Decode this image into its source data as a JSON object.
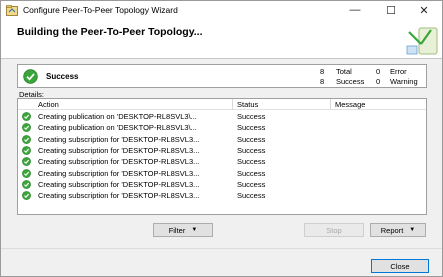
{
  "window": {
    "title": "Configure Peer-To-Peer Topology Wizard",
    "controls": {
      "minimize": "—",
      "maximize": "☐",
      "close": "✕"
    }
  },
  "header": {
    "title": "Building the Peer-To-Peer Topology..."
  },
  "summary": {
    "status": "Success",
    "total_count": "8",
    "total_label": "Total",
    "success_count": "8",
    "success_label": "Success",
    "error_count": "0",
    "error_label": "Error",
    "warning_count": "0",
    "warning_label": "Warning"
  },
  "details": {
    "label": "Details:",
    "columns": {
      "action": "Action",
      "status": "Status",
      "message": "Message"
    },
    "rows": [
      {
        "action": "Creating publication on 'DESKTOP-RL8SVL3\\...",
        "status": "Success",
        "message": ""
      },
      {
        "action": "Creating publication on 'DESKTOP-RL8SVL3\\...",
        "status": "Success",
        "message": ""
      },
      {
        "action": "Creating subscription for 'DESKTOP-RL8SVL3...",
        "status": "Success",
        "message": ""
      },
      {
        "action": "Creating subscription for 'DESKTOP-RL8SVL3...",
        "status": "Success",
        "message": ""
      },
      {
        "action": "Creating subscription for 'DESKTOP-RL8SVL3...",
        "status": "Success",
        "message": ""
      },
      {
        "action": "Creating subscription for 'DESKTOP-RL8SVL3...",
        "status": "Success",
        "message": ""
      },
      {
        "action": "Creating subscription for 'DESKTOP-RL8SVL3...",
        "status": "Success",
        "message": ""
      },
      {
        "action": "Creating subscription for 'DESKTOP-RL8SVL3...",
        "status": "Success",
        "message": ""
      }
    ]
  },
  "buttons": {
    "filter": "Filter",
    "stop": "Stop",
    "report": "Report",
    "close": "Close"
  },
  "colors": {
    "success_green": "#3aa53a",
    "accent": "#0078d7"
  },
  "icons": {
    "app": "wizard-icon",
    "status": "success-check-icon"
  }
}
